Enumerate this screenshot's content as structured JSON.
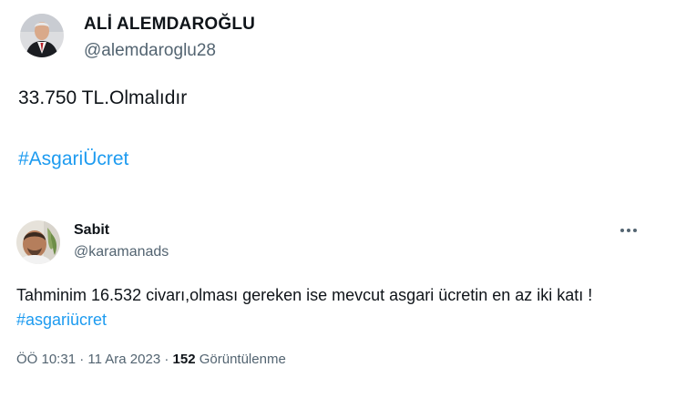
{
  "quoted_tweet": {
    "author_name": "ALİ ALEMDAROĞLU",
    "author_handle": "@alemdaroglu28",
    "text": "33.750 TL.Olmalıdır",
    "hashtag": "#AsgariÜcret"
  },
  "reply_tweet": {
    "author_name": "Sabit",
    "author_handle": "@karamanads",
    "more_icon": "ellipsis-horizontal",
    "text": "Tahminim 16.532 civarı,olması gereken ise mevcut asgari ücretin en az iki katı ! ",
    "hashtag": "#asgariücret",
    "time": "ÖÖ 10:31",
    "separator": "·",
    "date": "11 Ara 2023",
    "views_count": "152",
    "views_label": "Görüntülenme"
  },
  "colors": {
    "text_primary": "#0f1419",
    "text_secondary": "#536471",
    "link": "#1d9bf0"
  }
}
